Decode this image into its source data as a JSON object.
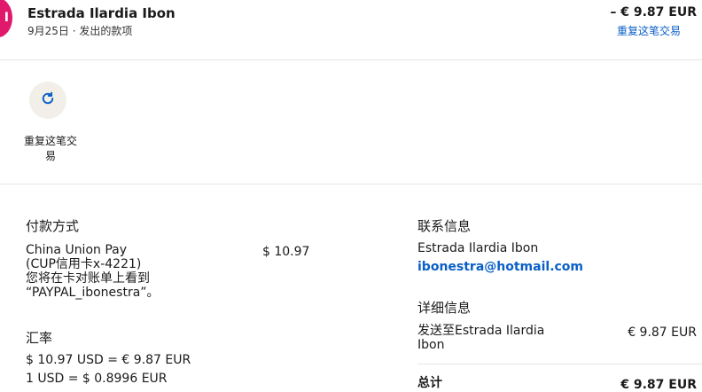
{
  "header": {
    "avatar_initial": "I",
    "merchant_name": "Estrada Ilardia Ibon",
    "subtitle": "9月25日 · 发出的款项",
    "amount": "– € 9.87 EUR",
    "repeat_link": "重复这笔交易"
  },
  "actions": {
    "repeat_label_line1": "重复这笔交",
    "repeat_label_line2": "易",
    "repeat_icon": "refresh-icon"
  },
  "payment": {
    "heading": "付款方式",
    "method_line1": "China Union Pay",
    "method_line2": "(CUP信用卡x-4221)",
    "method_line3": "您将在卡对账单上看到",
    "method_line4": "“PAYPAL_ibonestra”。",
    "method_amount": "$ 10.97"
  },
  "exchange": {
    "heading": "汇率",
    "line1": "$ 10.97 USD = € 9.87 EUR",
    "line2": "1 USD = $ 0.8996 EUR"
  },
  "contact": {
    "heading": "联系信息",
    "name": "Estrada Ilardia Ibon",
    "email": "ibonestra@hotmail.com"
  },
  "details": {
    "heading": "详细信息",
    "sent_to_line1": "发送至Estrada Ilardia",
    "sent_to_line2": "Ibon",
    "sent_amount": "€ 9.87 EUR",
    "total_label": "总计",
    "total_amount": "€ 9.87 EUR"
  },
  "colors": {
    "brand_pink": "#e0196d",
    "link_blue": "#0a5fc7"
  }
}
